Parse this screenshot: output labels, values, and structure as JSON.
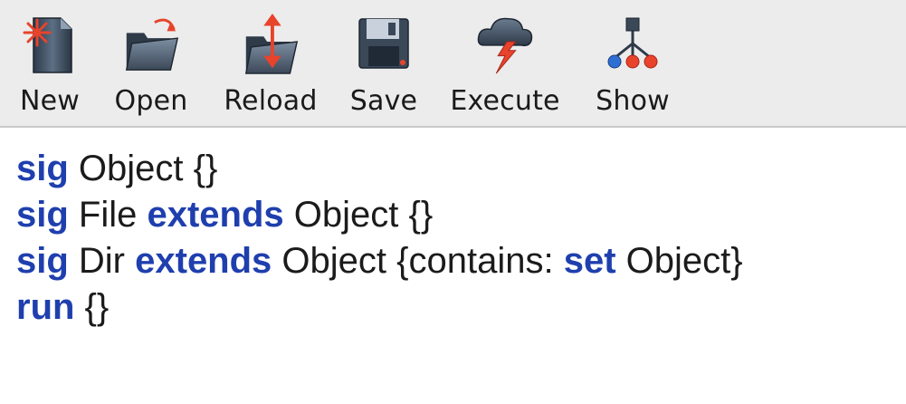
{
  "toolbar": {
    "items": [
      {
        "label": "New",
        "icon": "new-file-icon"
      },
      {
        "label": "Open",
        "icon": "open-folder-icon"
      },
      {
        "label": "Reload",
        "icon": "reload-icon"
      },
      {
        "label": "Save",
        "icon": "save-icon"
      },
      {
        "label": "Execute",
        "icon": "execute-icon"
      },
      {
        "label": "Show",
        "icon": "show-tree-icon"
      }
    ]
  },
  "editor": {
    "lines": [
      [
        {
          "t": "sig",
          "k": true
        },
        {
          "t": " Object {}",
          "k": false
        }
      ],
      [
        {
          "t": "sig",
          "k": true
        },
        {
          "t": " File ",
          "k": false
        },
        {
          "t": "extends",
          "k": true
        },
        {
          "t": " Object {}",
          "k": false
        }
      ],
      [
        {
          "t": "sig",
          "k": true
        },
        {
          "t": " Dir ",
          "k": false
        },
        {
          "t": "extends",
          "k": true
        },
        {
          "t": " Object {contains: ",
          "k": false
        },
        {
          "t": "set",
          "k": true
        },
        {
          "t": " Object}",
          "k": false
        }
      ],
      [
        {
          "t": "run",
          "k": true
        },
        {
          "t": " {}",
          "k": false
        }
      ]
    ],
    "keyword_color": "#1f3fae"
  }
}
